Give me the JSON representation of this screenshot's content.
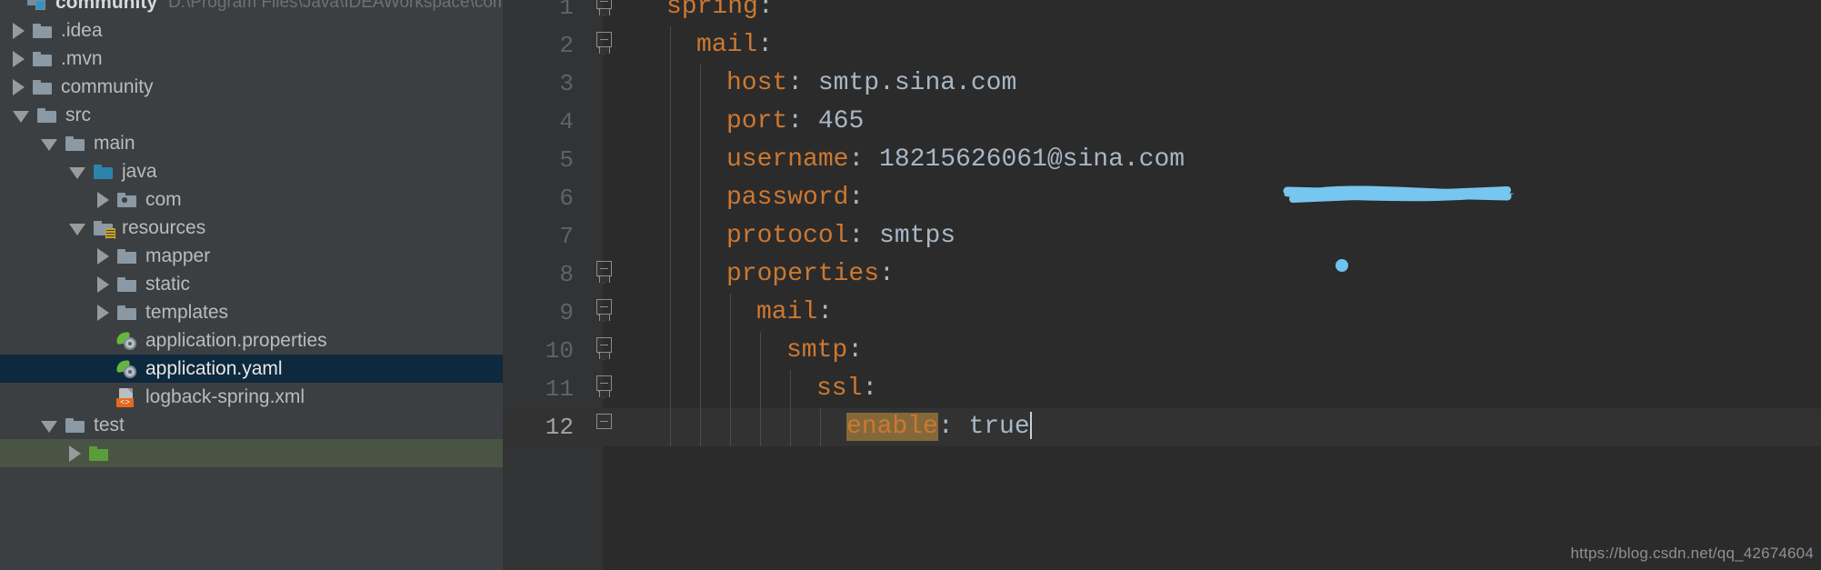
{
  "project": {
    "name": "community",
    "path": "D:\\Program Files\\Java\\IDEAWorkspace\\comm",
    "module_icon": "module-icon"
  },
  "tree": {
    "items": [
      {
        "label": ".idea",
        "depth": 0,
        "arrow": "collapsed",
        "icon": "folder",
        "selected": false
      },
      {
        "label": ".mvn",
        "depth": 0,
        "arrow": "collapsed",
        "icon": "folder",
        "selected": false
      },
      {
        "label": "community",
        "depth": 0,
        "arrow": "collapsed",
        "icon": "folder",
        "selected": false
      },
      {
        "label": "src",
        "depth": 0,
        "arrow": "expanded",
        "icon": "folder",
        "selected": false
      },
      {
        "label": "main",
        "depth": 1,
        "arrow": "expanded",
        "icon": "folder",
        "selected": false
      },
      {
        "label": "java",
        "depth": 2,
        "arrow": "expanded",
        "icon": "folder-source",
        "selected": false
      },
      {
        "label": "com",
        "depth": 3,
        "arrow": "collapsed",
        "icon": "folder-package",
        "selected": false
      },
      {
        "label": "resources",
        "depth": 2,
        "arrow": "expanded",
        "icon": "folder-resources",
        "selected": false
      },
      {
        "label": "mapper",
        "depth": 3,
        "arrow": "collapsed",
        "icon": "folder",
        "selected": false
      },
      {
        "label": "static",
        "depth": 3,
        "arrow": "collapsed",
        "icon": "folder",
        "selected": false
      },
      {
        "label": "templates",
        "depth": 3,
        "arrow": "collapsed",
        "icon": "folder",
        "selected": false
      },
      {
        "label": "application.properties",
        "depth": 3,
        "arrow": "none",
        "icon": "spring-file",
        "selected": false
      },
      {
        "label": "application.yaml",
        "depth": 3,
        "arrow": "none",
        "icon": "spring-file",
        "selected": true
      },
      {
        "label": "logback-spring.xml",
        "depth": 3,
        "arrow": "none",
        "icon": "xml-file",
        "selected": false
      },
      {
        "label": "test",
        "depth": 1,
        "arrow": "expanded",
        "icon": "folder",
        "selected": false
      }
    ],
    "xml_badge_text": "<>"
  },
  "editor": {
    "file": "application.yaml",
    "current_line": 12,
    "caret_line": 12,
    "highlight_token": "enable",
    "lines": [
      {
        "num": 1,
        "indent": 0,
        "key": "spring",
        "sep": ":",
        "value": "",
        "fold": "top"
      },
      {
        "num": 2,
        "indent": 1,
        "key": "mail",
        "sep": ":",
        "value": "",
        "fold": "mid"
      },
      {
        "num": 3,
        "indent": 2,
        "key": "host",
        "sep": ":",
        "value": "smtp.sina.com",
        "fold": ""
      },
      {
        "num": 4,
        "indent": 2,
        "key": "port",
        "sep": ":",
        "value": "465",
        "fold": ""
      },
      {
        "num": 5,
        "indent": 2,
        "key": "username",
        "sep": ":",
        "value": "18215626061@sina.com",
        "fold": ""
      },
      {
        "num": 6,
        "indent": 2,
        "key": "password",
        "sep": ":",
        "value": "",
        "fold": "",
        "redacted": true
      },
      {
        "num": 7,
        "indent": 2,
        "key": "protocol",
        "sep": ":",
        "value": "smtps",
        "fold": ""
      },
      {
        "num": 8,
        "indent": 2,
        "key": "properties",
        "sep": ":",
        "value": "",
        "fold": "mid"
      },
      {
        "num": 9,
        "indent": 3,
        "key": "mail",
        "sep": ":",
        "value": "",
        "fold": "mid"
      },
      {
        "num": 10,
        "indent": 4,
        "key": "smtp",
        "sep": ":",
        "value": "",
        "fold": "mid"
      },
      {
        "num": 11,
        "indent": 5,
        "key": "ssl",
        "sep": ":",
        "value": "",
        "fold": "mid"
      },
      {
        "num": 12,
        "indent": 6,
        "key": "enable",
        "sep": ":",
        "value": "true",
        "fold": "end"
      }
    ]
  },
  "annotations": {
    "redaction_color": "#77c6ef",
    "dot_color": "#6fc3ee",
    "watermark": "https://blog.csdn.net/qq_42674604"
  },
  "colors": {
    "panel_bg": "#3c3f41",
    "editor_bg": "#2b2b2b",
    "gutter_bg": "#313335",
    "selection_bg": "#0d293e",
    "test_root_bg": "#4a5444",
    "key_color": "#cc7832",
    "value_color": "#a9b7c6",
    "highlight_bg": "#83693a",
    "accent_blue": "#3592c4"
  }
}
